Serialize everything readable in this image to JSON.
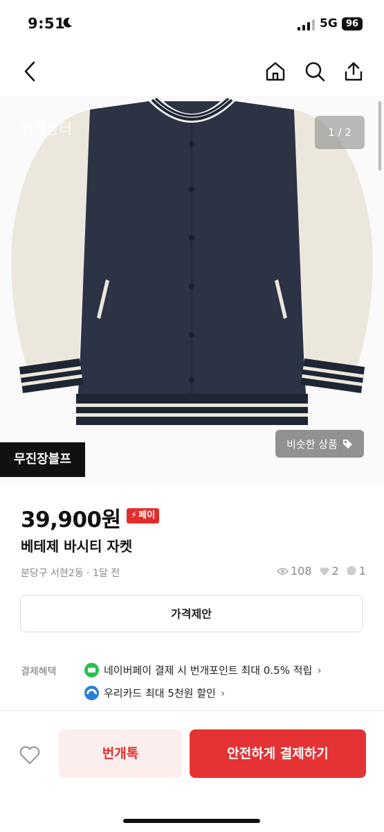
{
  "status": {
    "time": "9:51",
    "network": "5G",
    "battery": "96"
  },
  "nav": {
    "back_icon": "chevron-left-icon",
    "home_icon": "home-icon",
    "search_icon": "search-icon",
    "share_icon": "share-icon"
  },
  "image": {
    "counter": "1 / 2",
    "watermark": "번개장터",
    "shop_tag": "무진장블프",
    "similar_label": "비슷한 상품"
  },
  "product": {
    "price": "39,900원",
    "pay_badge": "페이",
    "title": "베테제 바시티 자켓",
    "location_time": "분당구 서현2동 · 1달 전",
    "views": "108",
    "likes": "2",
    "chats": "1"
  },
  "offer_label": "가격제안",
  "benefits": {
    "label": "결제혜택",
    "items": [
      {
        "text": "네이버페이 결제 시 번개포인트 최대 0.5% 적립",
        "icon": "naverpay-icon"
      },
      {
        "text": "우리카드 최대 5천원 할인",
        "icon": "wooricard-icon"
      }
    ]
  },
  "bottom": {
    "chat_label": "번개톡",
    "buy_label": "안전하게 결제하기"
  },
  "colors": {
    "accent": "#e53335",
    "accent_soft": "#fdeeee",
    "jacket_body": "#2b3345",
    "jacket_sleeve": "#ece7dc"
  }
}
